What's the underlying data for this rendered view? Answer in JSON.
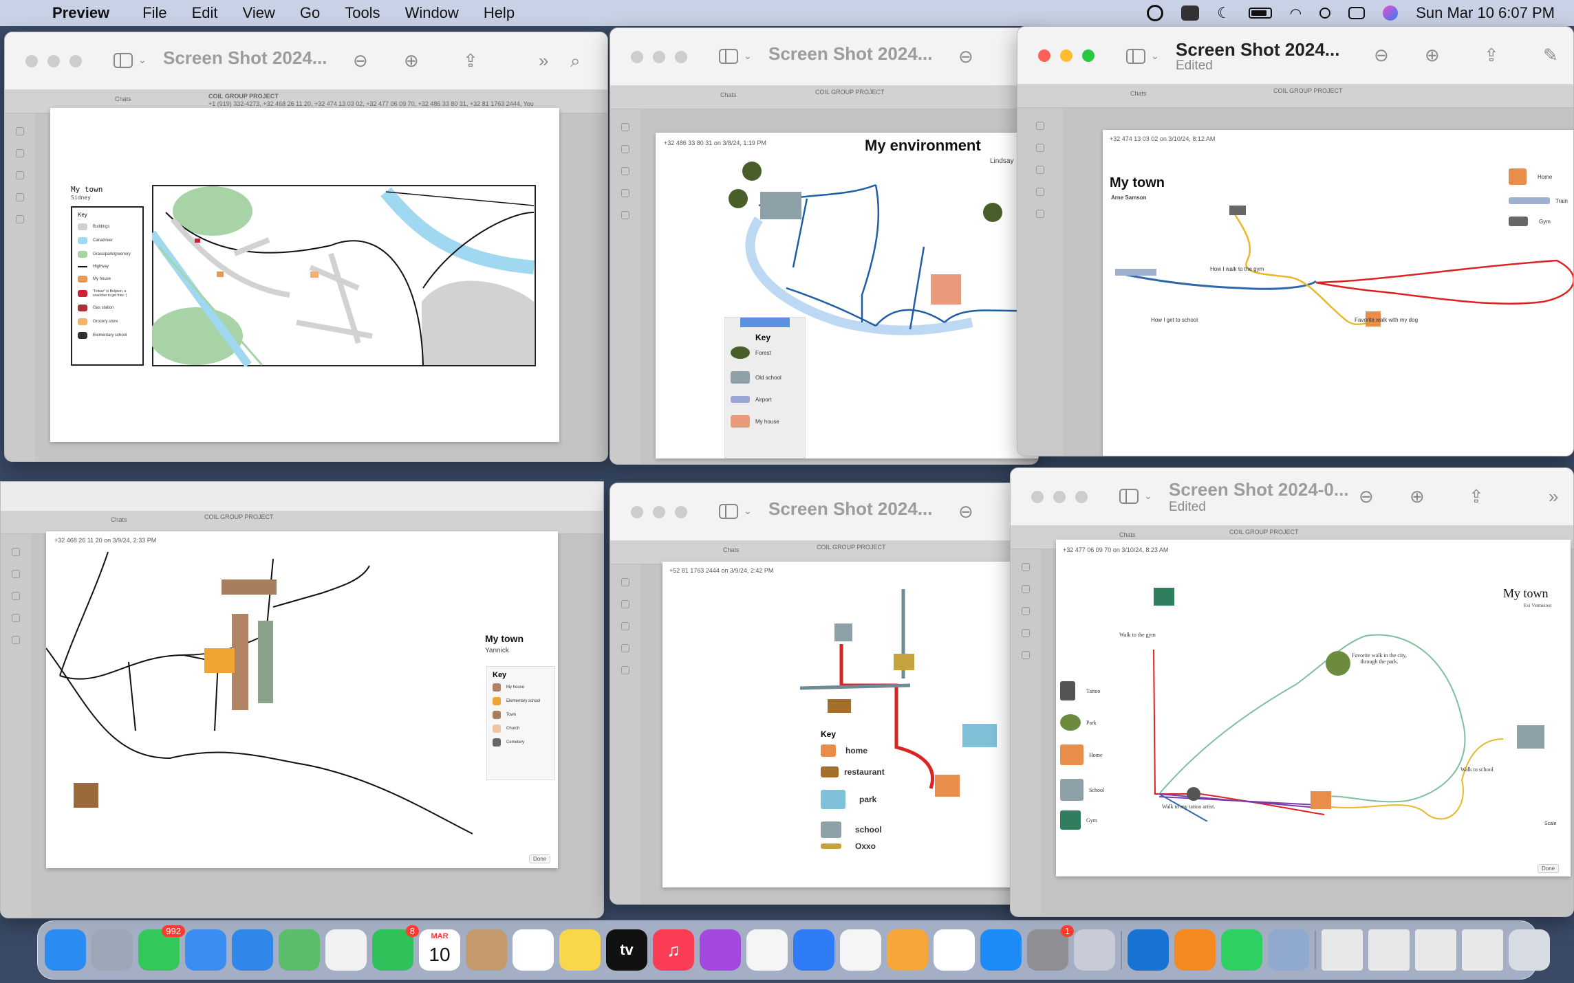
{
  "menubar": {
    "app_name": "Preview",
    "menus": [
      "File",
      "Edit",
      "View",
      "Go",
      "Tools",
      "Window",
      "Help"
    ],
    "datetime": "Sun Mar 10  6:07 PM",
    "status_icons": [
      "grammarly-icon",
      "office-icon",
      "moon-icon",
      "battery-icon",
      "wifi-icon",
      "spotlight-icon",
      "control-center-icon",
      "siri-icon"
    ]
  },
  "windows": {
    "w1": {
      "title": "Screen Shot 2024...",
      "coil": "COIL GROUP PROJECT",
      "coil_sub": "+1 (919) 332-4273, +32 468 26 11 20, +32 474 13 03 02, +32 477 06 09 70, +32 486 33 80 31, +32 81 1763 2444, You",
      "chats": "Chats",
      "map": {
        "title": "My town",
        "subtitle": "Sidney",
        "key_title": "Key",
        "key_items": [
          "Buildings",
          "Canal/river",
          "Grass/park/greenery",
          "Highway",
          "My house",
          "\"Frituur\" in Belgium, a snackbar to get fries :)",
          "Gas station",
          "Grocery store",
          "Elementary school"
        ]
      }
    },
    "w2": {
      "title": "Screen Shot 2024...",
      "header": "+32 486 33 80 31 on 3/8/24, 1:19 PM",
      "coil": "COIL GROUP PROJECT",
      "chats": "Chats",
      "map": {
        "title": "My environment",
        "subtitle": "Lindsay",
        "key_title": "Key",
        "key_items": [
          "Forest",
          "Old school",
          "Airport",
          "My house"
        ]
      }
    },
    "w3": {
      "title": "Screen Shot 2024...",
      "subtitle": "Edited",
      "header": "+32 474 13 03 02 on 3/10/24, 8:12 AM",
      "coil": "COIL GROUP PROJECT",
      "chats": "Chats",
      "map": {
        "title": "My town",
        "subtitle": "Arne Samson",
        "labels": {
          "gym_walk": "How I walk to the gym",
          "school": "How I get to school",
          "dog": "Favorite walk with my dog"
        },
        "legend": [
          "Home",
          "Train",
          "Gym"
        ]
      }
    },
    "w4": {
      "header": "+32 468 26 11 20 on 3/9/24, 2:33 PM",
      "coil": "COIL GROUP PROJECT",
      "chats": "Chats",
      "done": "Done",
      "map": {
        "title": "My town",
        "subtitle": "Yannick",
        "key_title": "Key",
        "key_items": [
          "My house",
          "Elementary school",
          "Town",
          "Church",
          "Cemetery"
        ]
      }
    },
    "w5": {
      "title": "Screen Shot 2024...",
      "header": "+52 81 1763 2444 on 3/9/24, 2:42 PM",
      "coil": "COIL GROUP PROJECT",
      "chats": "Chats",
      "map": {
        "key_title": "Key",
        "key_items": [
          "home",
          "restaurant",
          "park",
          "school",
          "Oxxo"
        ]
      }
    },
    "w6": {
      "title": "Screen Shot 2024-0...",
      "subtitle": "Edited",
      "header": "+32 477 06 09 70 on 3/10/24, 8:23 AM",
      "coil": "COIL GROUP PROJECT",
      "chats": "Chats",
      "done": "Done",
      "scale": "Scale",
      "map": {
        "title": "My town",
        "subtitle": "Evi Vermeiren",
        "labels": {
          "gym": "Walk to the gym",
          "park": "Favorite walk in the city, through the park.",
          "school": "Walk to school",
          "tattoo": "Walk to my tattoo artist."
        },
        "legend": [
          "Tattoo",
          "Park",
          "Home",
          "School",
          "Gym"
        ]
      }
    }
  },
  "dock": {
    "apps": [
      {
        "name": "finder",
        "color": "#2a8cf0",
        "glyph": ""
      },
      {
        "name": "launchpad",
        "color": "#9ea7b8",
        "glyph": ""
      },
      {
        "name": "messages",
        "color": "#34c759",
        "glyph": "",
        "badge": "992"
      },
      {
        "name": "mail",
        "color": "#3b8df2",
        "glyph": ""
      },
      {
        "name": "safari",
        "color": "#2f87ea",
        "glyph": ""
      },
      {
        "name": "maps",
        "color": "#5bbd6a",
        "glyph": ""
      },
      {
        "name": "photos",
        "color": "#f2f2f2",
        "glyph": ""
      },
      {
        "name": "facetime",
        "color": "#30c15a",
        "glyph": "",
        "badge": "8"
      },
      {
        "name": "calendar",
        "color": "#ffffff",
        "glyph": "10",
        "month": "MAR"
      },
      {
        "name": "contacts",
        "color": "#c49a6c",
        "glyph": ""
      },
      {
        "name": "reminders",
        "color": "#ffffff",
        "glyph": ""
      },
      {
        "name": "notes",
        "color": "#f8d84a",
        "glyph": ""
      },
      {
        "name": "apple-tv",
        "color": "#111111",
        "glyph": "tv"
      },
      {
        "name": "music",
        "color": "#fa3c55",
        "glyph": "♫"
      },
      {
        "name": "podcasts",
        "color": "#a449e0",
        "glyph": ""
      },
      {
        "name": "news",
        "color": "#f5f5f5",
        "glyph": ""
      },
      {
        "name": "keynote",
        "color": "#2e7cf6",
        "glyph": ""
      },
      {
        "name": "numbers",
        "color": "#f5f5f5",
        "glyph": ""
      },
      {
        "name": "pages",
        "color": "#f7a63a",
        "glyph": ""
      },
      {
        "name": "chrome",
        "color": "#ffffff",
        "glyph": ""
      },
      {
        "name": "app-store",
        "color": "#1e8cf7",
        "glyph": ""
      },
      {
        "name": "system-settings",
        "color": "#8e8e93",
        "glyph": "",
        "badge": "1"
      },
      {
        "name": "roblox",
        "color": "#c7ccd6",
        "glyph": ""
      }
    ],
    "apps2": [
      {
        "name": "outlook",
        "color": "#1673d2",
        "glyph": ""
      },
      {
        "name": "vlc",
        "color": "#f48a1f",
        "glyph": ""
      },
      {
        "name": "whatsapp",
        "color": "#2ed062",
        "glyph": ""
      },
      {
        "name": "preview",
        "color": "#8fa9cf",
        "glyph": ""
      }
    ]
  }
}
